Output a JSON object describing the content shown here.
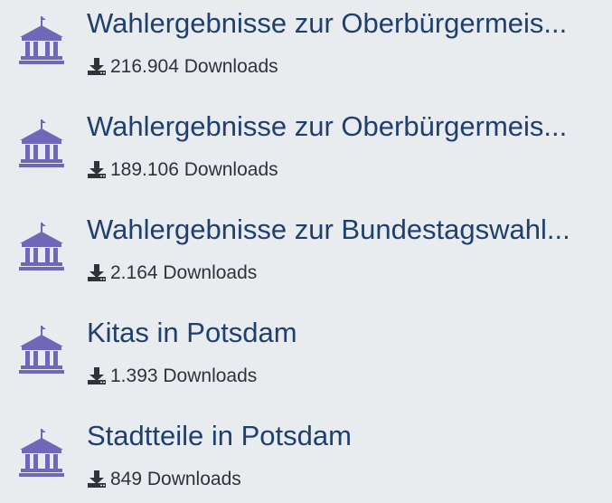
{
  "datasets": [
    {
      "title": "Wahlergebnisse zur Oberbürgermeis...",
      "downloads": "216.904 Downloads",
      "icon": "government-building-icon"
    },
    {
      "title": "Wahlergebnisse zur Oberbürgermeis...",
      "downloads": "189.106 Downloads",
      "icon": "government-building-icon"
    },
    {
      "title": "Wahlergebnisse zur Bundestagswahl...",
      "downloads": "2.164 Downloads",
      "icon": "government-building-icon"
    },
    {
      "title": "Kitas in Potsdam",
      "downloads": "1.393 Downloads",
      "icon": "government-building-icon"
    },
    {
      "title": "Stadtteile in Potsdam",
      "downloads": "849 Downloads",
      "icon": "government-building-icon"
    }
  ],
  "colors": {
    "background": "#e9ecef",
    "title": "#1f3f6f",
    "icon": "#6f67b8",
    "text": "#2f3338"
  }
}
